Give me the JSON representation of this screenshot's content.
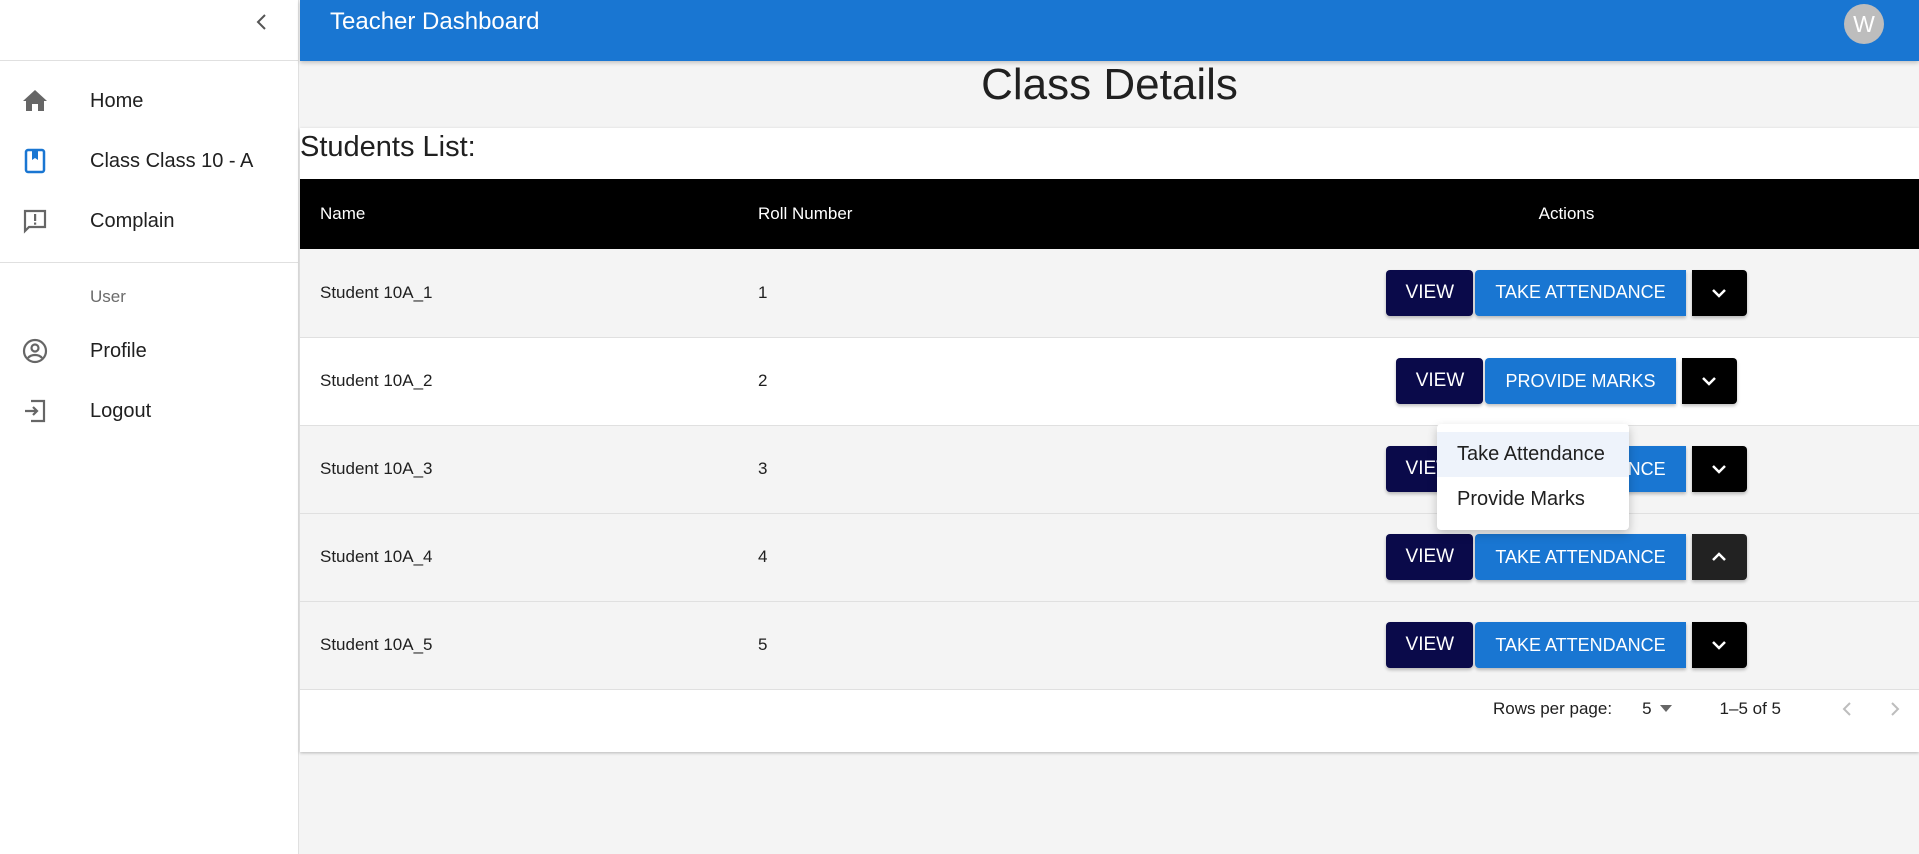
{
  "appbar": {
    "title": "Teacher Dashboard",
    "avatar_initial": "W"
  },
  "sidebar": {
    "items": [
      {
        "label": "Home",
        "icon": "home-icon"
      },
      {
        "label": "Class Class 10 - A",
        "icon": "class-icon"
      },
      {
        "label": "Complain",
        "icon": "announcement-icon"
      }
    ],
    "subheader": "User",
    "user_items": [
      {
        "label": "Profile",
        "icon": "account-circle-icon"
      },
      {
        "label": "Logout",
        "icon": "logout-icon"
      }
    ]
  },
  "main": {
    "title": "Class Details",
    "list_title": "Students List:",
    "columns": [
      "Name",
      "Roll Number",
      "Actions"
    ],
    "view_label": "VIEW",
    "rows": [
      {
        "name": "Student 10A_1",
        "roll": "1",
        "action": "TAKE ATTENDANCE"
      },
      {
        "name": "Student 10A_2",
        "roll": "2",
        "action": "PROVIDE MARKS"
      },
      {
        "name": "Student 10A_3",
        "roll": "3",
        "action": "TAKE ATTENDANCE"
      },
      {
        "name": "Student 10A_4",
        "roll": "4",
        "action": "TAKE ATTENDANCE"
      },
      {
        "name": "Student 10A_5",
        "roll": "5",
        "action": "TAKE ATTENDANCE"
      }
    ]
  },
  "menu": {
    "items": [
      "Take Attendance",
      "Provide Marks"
    ]
  },
  "pagination": {
    "rows_label": "Rows per page:",
    "rows_value": "5",
    "range": "1–5 of 5"
  },
  "colors": {
    "primary": "#1976d2",
    "view": "#0a0a4a",
    "header": "#000000"
  }
}
